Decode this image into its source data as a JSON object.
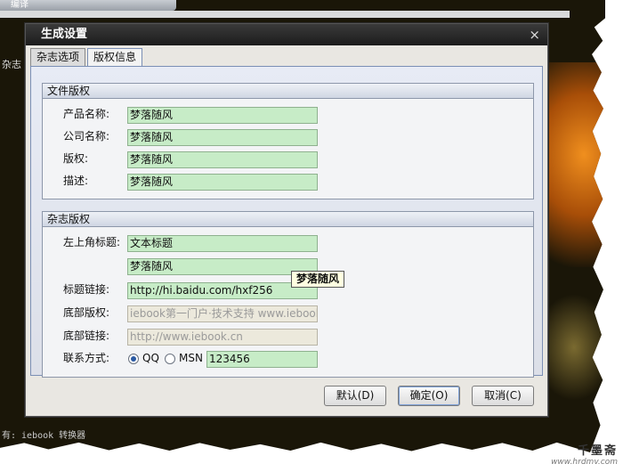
{
  "background": {
    "top_tab": "编译",
    "side_text": "杂志",
    "bottom_text": "有: iebook 转换器"
  },
  "dialog": {
    "title": "生成设置",
    "close_glyph": "×",
    "tabs": [
      {
        "label": "杂志选项",
        "active": false
      },
      {
        "label": "版权信息",
        "active": true
      }
    ],
    "file_copyright": {
      "title": "文件版权",
      "fields": [
        {
          "label": "产品名称:",
          "value": "梦落随风"
        },
        {
          "label": "公司名称:",
          "value": "梦落随风"
        },
        {
          "label": "版权:",
          "value": "梦落随风"
        },
        {
          "label": "描述:",
          "value": "梦落随风"
        }
      ]
    },
    "magazine_copyright": {
      "title": "杂志版权",
      "corner_title_label": "左上角标题:",
      "corner_title_value": "文本标题",
      "corner_title_value2": "梦落随风",
      "tooltip": "梦落随风",
      "title_link_label": "标题链接:",
      "title_link_value": "http://hi.baidu.com/hxf256",
      "bottom_copyright_label": "底部版权:",
      "bottom_copyright_value": "iebook第一门户·技术支持 www.iebook.cn",
      "bottom_link_label": "底部链接:",
      "bottom_link_value": "http://www.iebook.cn",
      "contact_label": "联系方式:",
      "contact_options": [
        {
          "label": "QQ",
          "checked": true
        },
        {
          "label": "MSN",
          "checked": false
        }
      ],
      "contact_value": "123456"
    },
    "buttons": {
      "default": "默认(D)",
      "ok": "确定(O)",
      "cancel": "取消(C)"
    }
  },
  "watermark": {
    "logo": "千墨斋",
    "url": "www.hrdmv.com"
  }
}
